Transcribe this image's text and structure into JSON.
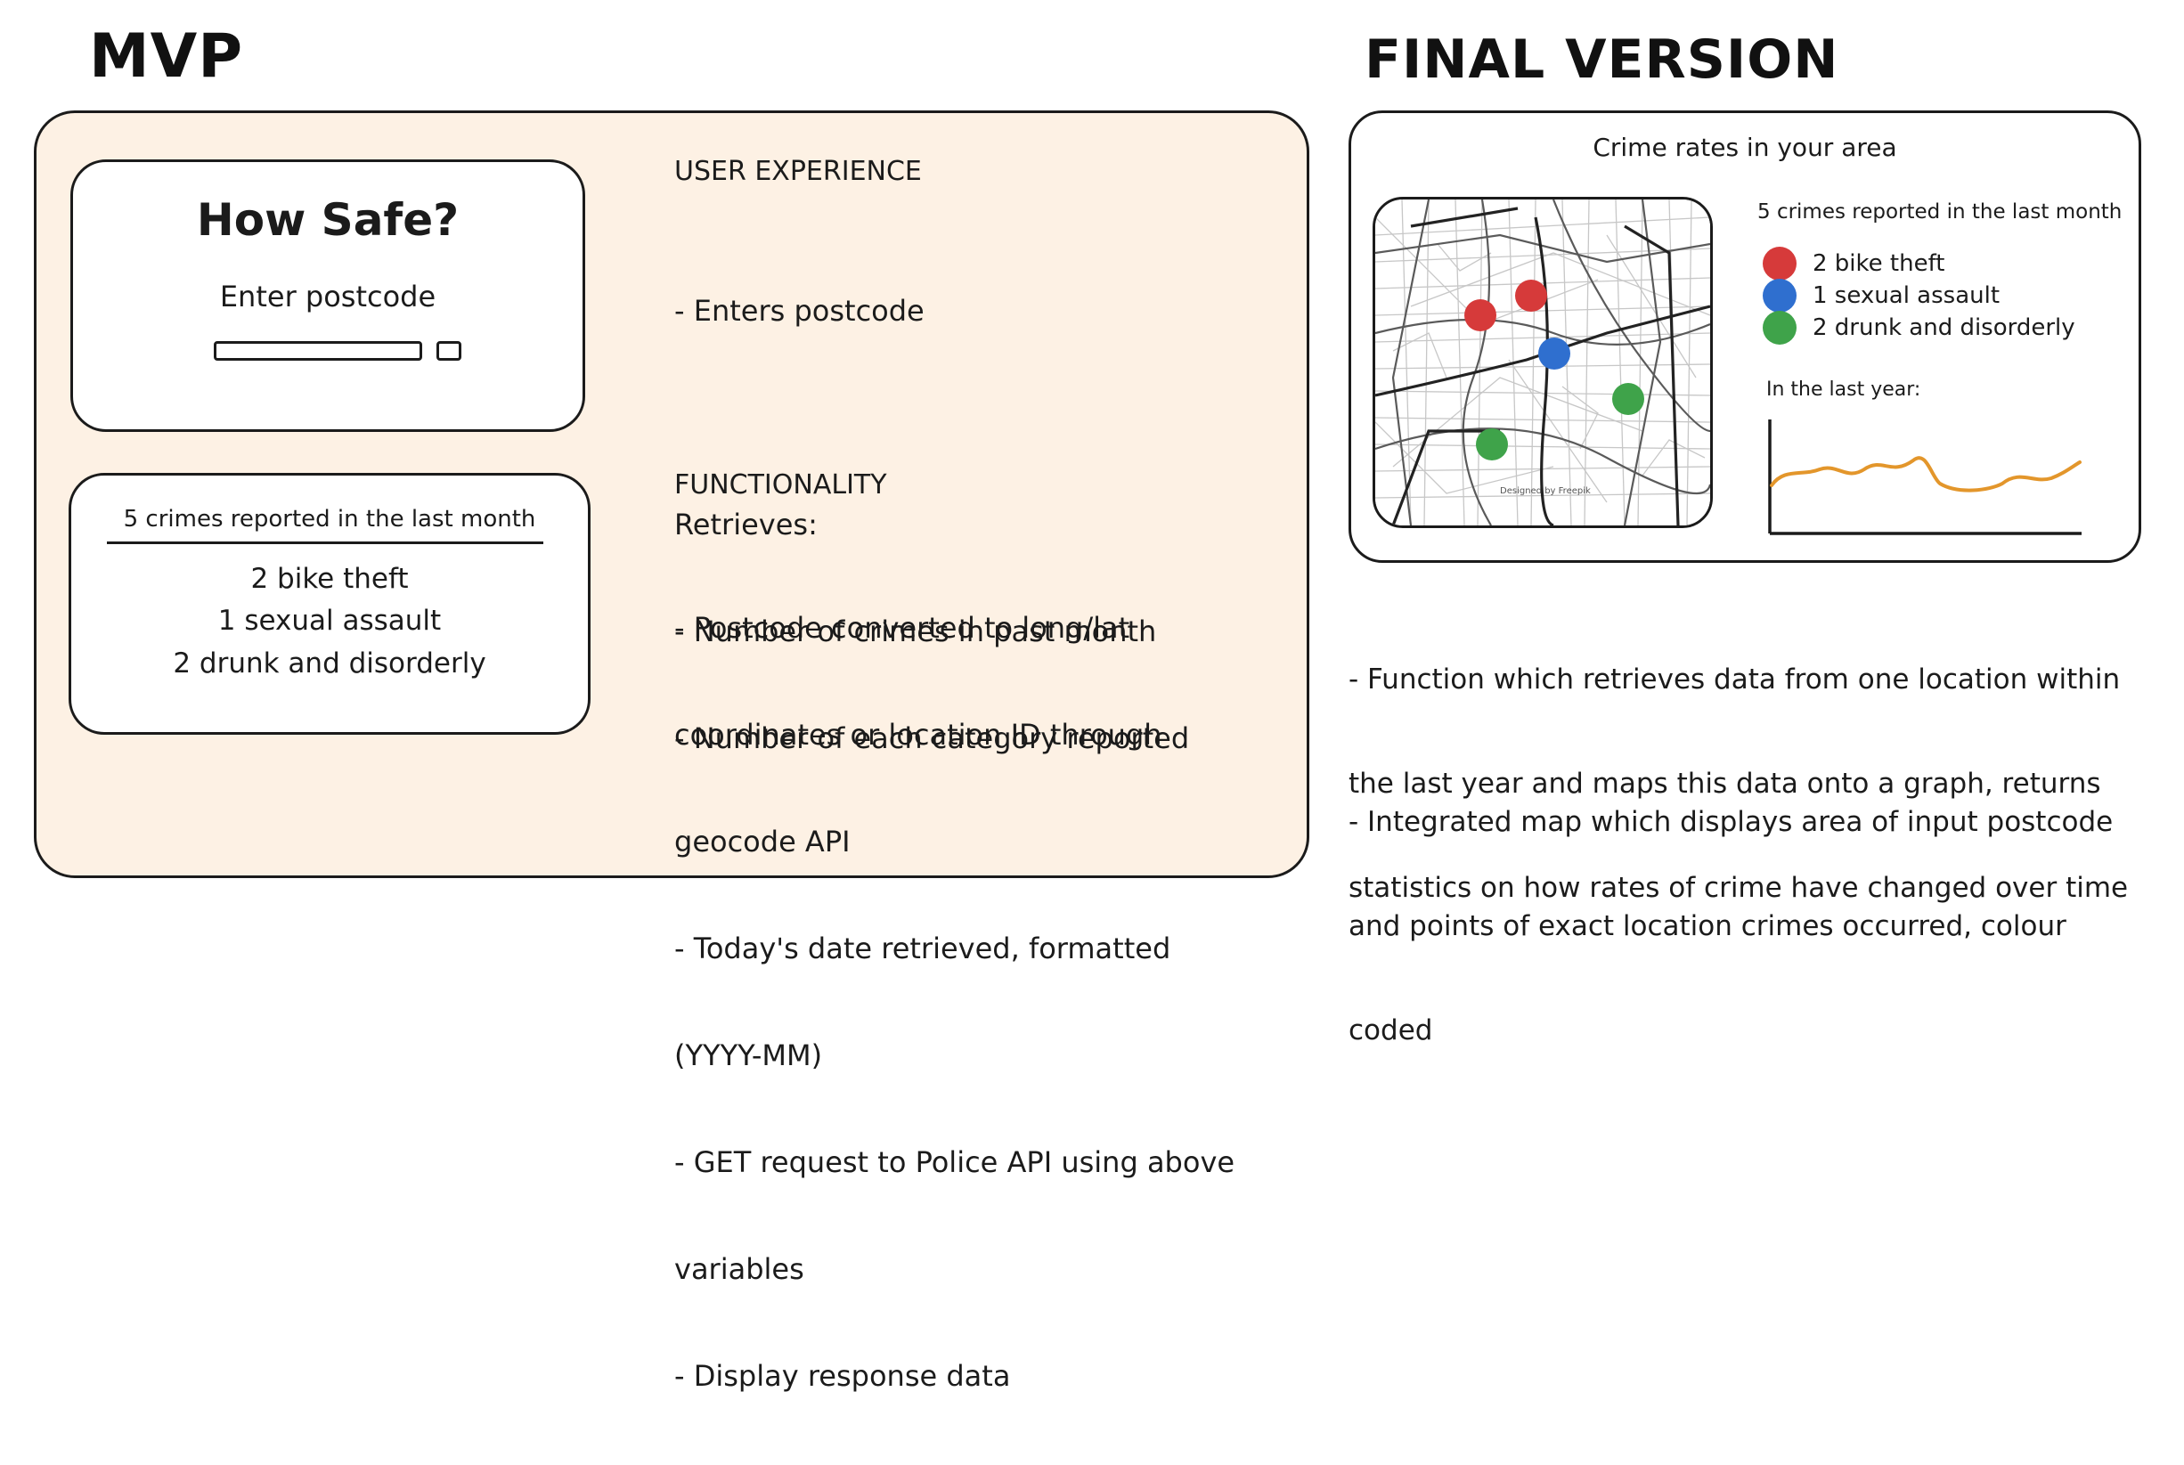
{
  "headings": {
    "mvp": "MVP",
    "final": "FINAL VERSION"
  },
  "mvp": {
    "app_card": {
      "title": "How Safe?",
      "prompt": "Enter postcode"
    },
    "results_card": {
      "header": "5 crimes reported in the last month",
      "items": [
        "2 bike theft",
        "1 sexual assault",
        "2 drunk and disorderly"
      ]
    },
    "user_experience": {
      "title": "USER EXPERIENCE",
      "lines": [
        "- Enters postcode",
        "",
        "Retrieves:",
        "- Number of crimes in past month",
        "- Number of each category reported"
      ]
    },
    "functionality": {
      "title": "FUNCTIONALITY",
      "lines": [
        "- Postcode converted to long/lat",
        "coordinates or location ID through",
        "geocode API",
        "- Today's date retrieved, formatted",
        "(YYYY-MM)",
        "- GET request to Police API using above",
        "variables",
        "- Display response data"
      ]
    }
  },
  "final": {
    "panel_title": "Crime rates in your area",
    "summary": "5 crimes reported in the last month",
    "legend": [
      {
        "label": "2 bike theft",
        "color": "#d63a3a"
      },
      {
        "label": "1 sexual assault",
        "color": "#2f6fcf"
      },
      {
        "label": "2 drunk and disorderly",
        "color": "#3fa34a"
      }
    ],
    "graph_label": "In the last year:",
    "map_credit": "Designed by Freepik",
    "graph_color": "#e3962b",
    "notes": [
      [
        "- Function which retrieves data from one location within",
        "the last year and maps this data onto a graph, returns",
        "statistics on how rates of crime have changed over time"
      ],
      [
        "- Integrated map which displays area of input postcode",
        "and points of exact location crimes occurred, colour",
        "coded"
      ]
    ]
  }
}
